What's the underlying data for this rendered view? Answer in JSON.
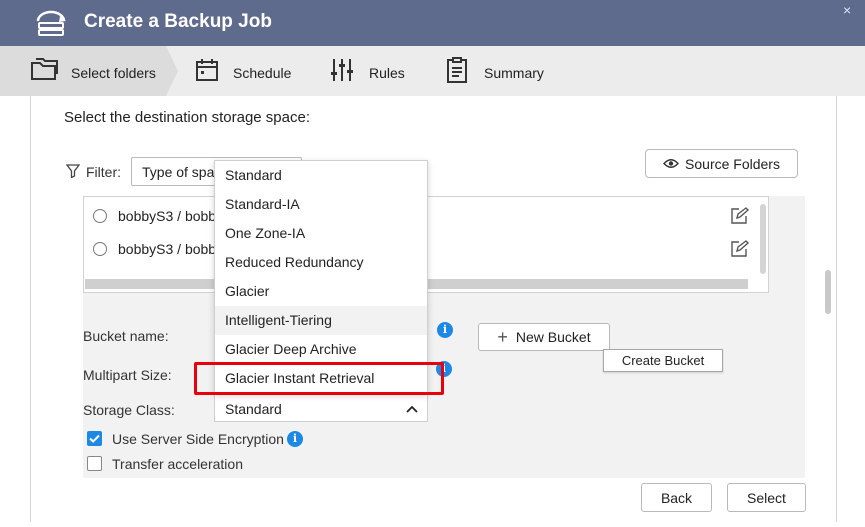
{
  "window": {
    "title": "Create a Backup Job",
    "close_glyph": "×"
  },
  "steps": [
    {
      "label": "Select folders",
      "icon": "folders-icon",
      "active": true
    },
    {
      "label": "Schedule",
      "icon": "calendar-icon"
    },
    {
      "label": "Rules",
      "icon": "sliders-icon"
    },
    {
      "label": "Summary",
      "icon": "clipboard-icon"
    }
  ],
  "main": {
    "heading": "Select the destination storage space:",
    "filter_label": "Filter:",
    "filter_select_value": "Type of spac",
    "source_folders_button": "Source Folders",
    "rows": [
      {
        "label": "bobbyS3 / bobb"
      },
      {
        "label": "bobbyS3 / bobb"
      }
    ]
  },
  "dropdown": {
    "options": [
      "Standard",
      "Standard-IA",
      "One Zone-IA",
      "Reduced Redundancy",
      "Glacier",
      "Intelligent-Tiering",
      "Glacier Deep Archive",
      "Glacier Instant Retrieval"
    ],
    "hovered": "Intelligent-Tiering",
    "highlighted": "Glacier Instant Retrieval",
    "highlight_color": "#e8000a"
  },
  "form": {
    "bucket_name_label": "Bucket name:",
    "new_bucket_button": "New Bucket",
    "new_bucket_glyph": "+",
    "create_bucket_tooltip": "Create Bucket",
    "multipart_size_label": "Multipart Size:",
    "storage_class_label": "Storage Class:",
    "storage_class_value": "Standard",
    "sse_label": "Use Server Side Encryption",
    "sse_checked": true,
    "transfer_label": "Transfer acceleration",
    "transfer_checked": false,
    "info_glyph": "i"
  },
  "footer": {
    "back_button": "Back",
    "select_button": "Select"
  },
  "colors": {
    "header": "#5f6b8c",
    "accent": "#1e88e5",
    "highlight": "#e8000a"
  }
}
